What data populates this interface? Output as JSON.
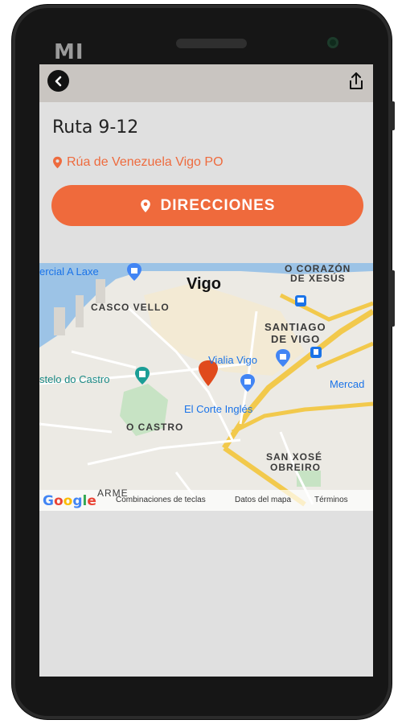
{
  "phone": {
    "brand": "MI"
  },
  "header": {
    "back_icon": "chevron-left-icon",
    "share_icon": "share-icon"
  },
  "content": {
    "title": "Ruta 9-12",
    "address": "Rúa de Venezuela Vigo PO",
    "address_icon": "location-pin-icon",
    "directions_label": "DIRECCIONES",
    "directions_icon": "location-pin-icon",
    "accent_color": "#ef6a3c"
  },
  "map": {
    "city": "Vigo",
    "labels": {
      "comercial": "ercial A Laxe",
      "corazon": "O CORAZÓN",
      "xesus": "DE XESÚS",
      "casco": "CASCO VELLO",
      "santiago1": "SANTIAGO",
      "santiago2": "DE VIGO",
      "vialia": "Vialia Vigo",
      "castelo": "stelo do Castro",
      "mercad": "Mercad",
      "elcorte": "El Corte Inglés",
      "ocastro": "O CASTRO",
      "sanxose1": "SAN XOSÉ",
      "sanxose2": "OBREIRO",
      "google": "Google",
      "carme": "ARME"
    },
    "attribution": {
      "keys": "Combinaciones de teclas",
      "data": "Datos del mapa",
      "terms": "Términos"
    }
  }
}
